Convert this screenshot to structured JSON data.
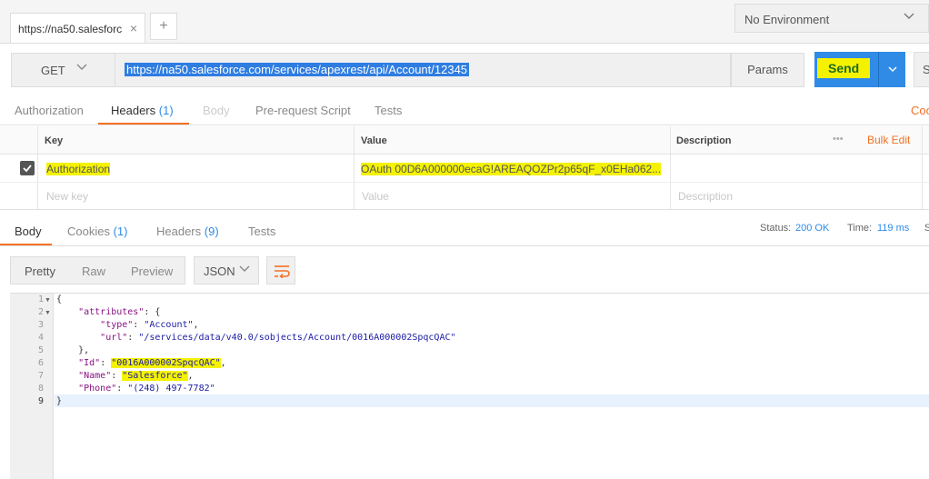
{
  "tabs": [
    {
      "label": "https://na50.salesforc",
      "close": "×"
    }
  ],
  "new_tab_label": "+",
  "environment": {
    "selected": "No Environment"
  },
  "request": {
    "method": "GET",
    "url": "https://na50.salesforce.com/services/apexrest/api/Account/12345",
    "params_label": "Params",
    "send_label": "Send",
    "save_label": "S"
  },
  "request_tabs": [
    {
      "label": "Authorization",
      "count": ""
    },
    {
      "label": "Headers",
      "count": "(1)"
    },
    {
      "label": "Body",
      "count": ""
    },
    {
      "label": "Pre-request Script",
      "count": ""
    },
    {
      "label": "Tests",
      "count": ""
    }
  ],
  "code_link": "Coo",
  "headers_table": {
    "columns": {
      "key": "Key",
      "value": "Value",
      "description": "Description"
    },
    "more": "•••",
    "bulk_edit": "Bulk Edit",
    "rows": [
      {
        "key": "Authorization",
        "value": "OAuth 00D6A000000ecaG!AREAQOZPr2p65qF_x0EHa062...",
        "description": ""
      }
    ],
    "placeholders": {
      "key": "New key",
      "value": "Value",
      "description": "Description"
    }
  },
  "response_tabs": [
    {
      "label": "Body",
      "count": ""
    },
    {
      "label": "Cookies",
      "count": "(1)"
    },
    {
      "label": "Headers",
      "count": "(9)"
    },
    {
      "label": "Tests",
      "count": ""
    }
  ],
  "status": {
    "status_label": "Status:",
    "status_value": "200 OK",
    "time_label": "Time:",
    "time_value": "119 ms",
    "size_label": "S"
  },
  "view": {
    "modes": [
      "Pretty",
      "Raw",
      "Preview"
    ],
    "format": "JSON"
  },
  "response_lines": [
    "1",
    "2",
    "3",
    "4",
    "5",
    "6",
    "7",
    "8",
    "9"
  ],
  "response_body": {
    "open": "{",
    "attributes_key": "\"attributes\"",
    "type_key": "\"type\"",
    "type_value": "\"Account\"",
    "url_key": "\"url\"",
    "url_value": "\"/services/data/v40.0/sobjects/Account/0016A000002SpqcQAC\"",
    "close_inner": "},",
    "id_key": "\"Id\"",
    "id_value": "\"0016A000002SpqcQAC\"",
    "name_key": "\"Name\"",
    "name_value": "\"Salesforce\"",
    "phone_key": "\"Phone\"",
    "phone_value": "\"(248) 497-7782\"",
    "close": "}"
  }
}
